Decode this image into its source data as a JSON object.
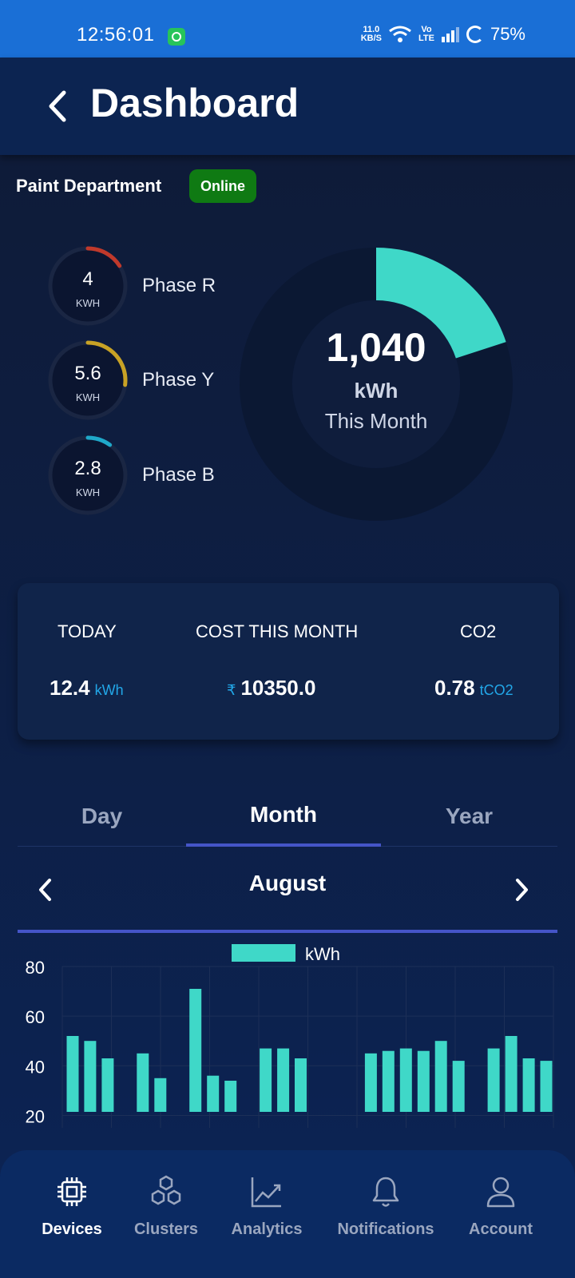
{
  "status_bar": {
    "time": "12:56:01",
    "net_speed_value": "11.0",
    "net_speed_unit": "KB/S",
    "volte_top": "Vo",
    "volte_bottom": "LTE",
    "battery": "75%"
  },
  "header": {
    "title": "Dashboard"
  },
  "device": {
    "name": "Paint Department",
    "status": "Online"
  },
  "phases": [
    {
      "value": "4",
      "unit": "KWH",
      "label": "Phase R",
      "color": "#c0392b",
      "fill_fraction": 0.16
    },
    {
      "value": "5.6",
      "unit": "KWH",
      "label": "Phase Y",
      "color": "#c8a225",
      "fill_fraction": 0.27
    },
    {
      "value": "2.8",
      "unit": "KWH",
      "label": "Phase B",
      "color": "#1fa8c9",
      "fill_fraction": 0.1
    }
  ],
  "monthly": {
    "value": "1,040",
    "unit": "kWh",
    "caption": "This Month",
    "color": "#3fd8c8",
    "fill_fraction": 0.2
  },
  "stats": {
    "today": {
      "label": "TODAY",
      "value": "12.4",
      "unit": "kWh"
    },
    "cost": {
      "label": "COST THIS MONTH",
      "currency": "₹",
      "value": "10350.0"
    },
    "co2": {
      "label": "CO2",
      "value": "0.78",
      "unit": "tCO2"
    }
  },
  "tabs": {
    "items": [
      "Day",
      "Month",
      "Year"
    ],
    "active": "Month"
  },
  "period": {
    "label": "August"
  },
  "chart_data": {
    "type": "bar",
    "series": [
      {
        "name": "kWh",
        "values": [
          52,
          50,
          43,
          null,
          45,
          35,
          null,
          71,
          36,
          34,
          null,
          47,
          47,
          43,
          null,
          null,
          null,
          45,
          46,
          47,
          46,
          50,
          42,
          null,
          47,
          52,
          43,
          42
        ]
      }
    ],
    "yticks": [
      20,
      40,
      60,
      80
    ],
    "ylim": [
      15,
      80
    ],
    "legend": "top-center",
    "grid": true,
    "bar_color": "#3fd8c8"
  },
  "bottom_nav": [
    {
      "label": "Devices",
      "icon": "chip-icon",
      "active": true
    },
    {
      "label": "Clusters",
      "icon": "hexagons-icon",
      "active": false
    },
    {
      "label": "Analytics",
      "icon": "trend-chart-icon",
      "active": false
    },
    {
      "label": "Notifications",
      "icon": "bell-icon",
      "active": false
    },
    {
      "label": "Account",
      "icon": "user-icon",
      "active": false
    }
  ]
}
